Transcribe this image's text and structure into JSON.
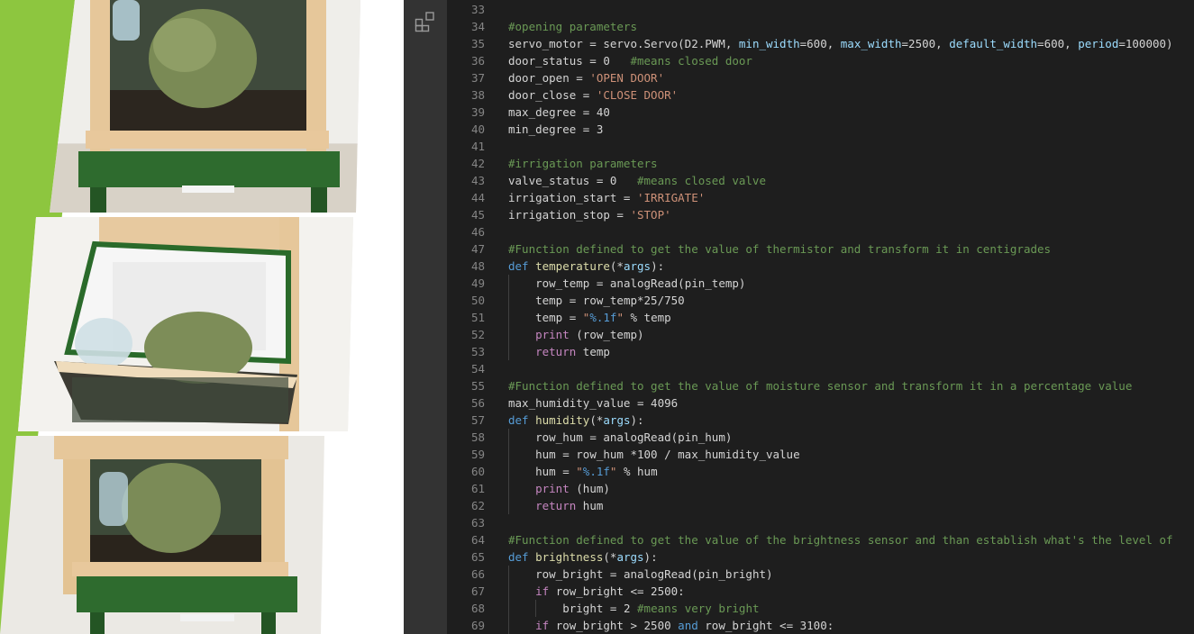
{
  "colors": {
    "editor_bg": "#1e1e1e",
    "activity_bar": "#333333",
    "comment": "#6a9955",
    "keyword": "#569cd6",
    "control": "#c586c0",
    "string": "#ce9178",
    "number": "#b5cea8",
    "function": "#dcdcaa",
    "parameter": "#9cdcfe",
    "text": "#d4d4d4",
    "line_number": "#858585",
    "accent_green": "#8dc63f"
  },
  "activity_bar": {
    "icon": "extensions-icon"
  },
  "photos": [
    {
      "name": "greenhouse-closed-photo"
    },
    {
      "name": "greenhouse-open-photo"
    },
    {
      "name": "greenhouse-closed-front-photo"
    }
  ],
  "code_lines": [
    {
      "n": "33",
      "indent": 0,
      "tokens": []
    },
    {
      "n": "34",
      "indent": 0,
      "tokens": [
        {
          "t": "#opening parameters",
          "c": "cm"
        }
      ]
    },
    {
      "n": "35",
      "indent": 0,
      "tokens": [
        {
          "t": "servo_motor = servo.",
          "c": ""
        },
        {
          "t": "Servo",
          "c": ""
        },
        {
          "t": "(D2.PWM, ",
          "c": ""
        },
        {
          "t": "min_width",
          "c": "par"
        },
        {
          "t": "=600, ",
          "c": ""
        },
        {
          "t": "max_width",
          "c": "par"
        },
        {
          "t": "=2500, ",
          "c": ""
        },
        {
          "t": "default_width",
          "c": "par"
        },
        {
          "t": "=600, ",
          "c": ""
        },
        {
          "t": "period",
          "c": "par"
        },
        {
          "t": "=100000)",
          "c": ""
        }
      ]
    },
    {
      "n": "36",
      "indent": 0,
      "tokens": [
        {
          "t": "door_status = 0   ",
          "c": ""
        },
        {
          "t": "#means closed door",
          "c": "cm"
        }
      ]
    },
    {
      "n": "37",
      "indent": 0,
      "tokens": [
        {
          "t": "door_open = ",
          "c": ""
        },
        {
          "t": "'OPEN DOOR'",
          "c": "str"
        }
      ]
    },
    {
      "n": "38",
      "indent": 0,
      "tokens": [
        {
          "t": "door_close = ",
          "c": ""
        },
        {
          "t": "'CLOSE DOOR'",
          "c": "str"
        }
      ]
    },
    {
      "n": "39",
      "indent": 0,
      "tokens": [
        {
          "t": "max_degree = 40",
          "c": ""
        }
      ]
    },
    {
      "n": "40",
      "indent": 0,
      "tokens": [
        {
          "t": "min_degree = 3",
          "c": ""
        }
      ]
    },
    {
      "n": "41",
      "indent": 0,
      "tokens": []
    },
    {
      "n": "42",
      "indent": 0,
      "tokens": [
        {
          "t": "#irrigation parameters",
          "c": "cm"
        }
      ]
    },
    {
      "n": "43",
      "indent": 0,
      "tokens": [
        {
          "t": "valve_status = 0   ",
          "c": ""
        },
        {
          "t": "#means closed valve",
          "c": "cm"
        }
      ]
    },
    {
      "n": "44",
      "indent": 0,
      "tokens": [
        {
          "t": "irrigation_start = ",
          "c": ""
        },
        {
          "t": "'IRRIGATE'",
          "c": "str"
        }
      ]
    },
    {
      "n": "45",
      "indent": 0,
      "tokens": [
        {
          "t": "irrigation_stop = ",
          "c": ""
        },
        {
          "t": "'STOP'",
          "c": "str"
        }
      ]
    },
    {
      "n": "46",
      "indent": 0,
      "tokens": []
    },
    {
      "n": "47",
      "indent": 0,
      "tokens": [
        {
          "t": "#Function defined to get the value of thermistor and transform it in centigrades",
          "c": "cm"
        }
      ]
    },
    {
      "n": "48",
      "indent": 0,
      "tokens": [
        {
          "t": "def ",
          "c": "kw"
        },
        {
          "t": "temperature",
          "c": "fn"
        },
        {
          "t": "(*",
          "c": ""
        },
        {
          "t": "args",
          "c": "par"
        },
        {
          "t": "):",
          "c": ""
        }
      ]
    },
    {
      "n": "49",
      "indent": 1,
      "tokens": [
        {
          "t": "row_temp = ",
          "c": ""
        },
        {
          "t": "analogRead",
          "c": ""
        },
        {
          "t": "(pin_temp)",
          "c": ""
        }
      ]
    },
    {
      "n": "50",
      "indent": 1,
      "tokens": [
        {
          "t": "temp = row_temp*25/750",
          "c": ""
        }
      ]
    },
    {
      "n": "51",
      "indent": 1,
      "tokens": [
        {
          "t": "temp = ",
          "c": ""
        },
        {
          "t": "\"",
          "c": "str"
        },
        {
          "t": "%.1f",
          "c": "fmt"
        },
        {
          "t": "\"",
          "c": "str"
        },
        {
          "t": " % temp",
          "c": ""
        }
      ]
    },
    {
      "n": "52",
      "indent": 1,
      "tokens": [
        {
          "t": "print",
          "c": "ctl"
        },
        {
          "t": " (row_temp)",
          "c": ""
        }
      ]
    },
    {
      "n": "53",
      "indent": 1,
      "tokens": [
        {
          "t": "return",
          "c": "ctl"
        },
        {
          "t": " temp",
          "c": ""
        }
      ]
    },
    {
      "n": "54",
      "indent": 0,
      "tokens": []
    },
    {
      "n": "55",
      "indent": 0,
      "tokens": [
        {
          "t": "#Function defined to get the value of moisture sensor and transform it in a percentage value",
          "c": "cm"
        }
      ]
    },
    {
      "n": "56",
      "indent": 0,
      "tokens": [
        {
          "t": "max_humidity_value = 4096",
          "c": ""
        }
      ]
    },
    {
      "n": "57",
      "indent": 0,
      "tokens": [
        {
          "t": "def ",
          "c": "kw"
        },
        {
          "t": "humidity",
          "c": "fn"
        },
        {
          "t": "(*",
          "c": ""
        },
        {
          "t": "args",
          "c": "par"
        },
        {
          "t": "):",
          "c": ""
        }
      ]
    },
    {
      "n": "58",
      "indent": 1,
      "tokens": [
        {
          "t": "row_hum = ",
          "c": ""
        },
        {
          "t": "analogRead",
          "c": ""
        },
        {
          "t": "(pin_hum)",
          "c": ""
        }
      ]
    },
    {
      "n": "59",
      "indent": 1,
      "tokens": [
        {
          "t": "hum = row_hum *100 / max_humidity_value",
          "c": ""
        }
      ]
    },
    {
      "n": "60",
      "indent": 1,
      "tokens": [
        {
          "t": "hum = ",
          "c": ""
        },
        {
          "t": "\"",
          "c": "str"
        },
        {
          "t": "%.1f",
          "c": "fmt"
        },
        {
          "t": "\"",
          "c": "str"
        },
        {
          "t": " % hum",
          "c": ""
        }
      ]
    },
    {
      "n": "61",
      "indent": 1,
      "tokens": [
        {
          "t": "print",
          "c": "ctl"
        },
        {
          "t": " (hum)",
          "c": ""
        }
      ]
    },
    {
      "n": "62",
      "indent": 1,
      "tokens": [
        {
          "t": "return",
          "c": "ctl"
        },
        {
          "t": " hum",
          "c": ""
        }
      ]
    },
    {
      "n": "63",
      "indent": 0,
      "tokens": []
    },
    {
      "n": "64",
      "indent": 0,
      "tokens": [
        {
          "t": "#Function defined to get the value of the brightness sensor and than establish what's the level of",
          "c": "cm"
        }
      ]
    },
    {
      "n": "65",
      "indent": 0,
      "tokens": [
        {
          "t": "def ",
          "c": "kw"
        },
        {
          "t": "brightness",
          "c": "fn"
        },
        {
          "t": "(*",
          "c": ""
        },
        {
          "t": "args",
          "c": "par"
        },
        {
          "t": "):",
          "c": ""
        }
      ]
    },
    {
      "n": "66",
      "indent": 1,
      "tokens": [
        {
          "t": "row_bright = ",
          "c": ""
        },
        {
          "t": "analogRead",
          "c": ""
        },
        {
          "t": "(pin_bright)",
          "c": ""
        }
      ]
    },
    {
      "n": "67",
      "indent": 1,
      "tokens": [
        {
          "t": "if",
          "c": "ctl"
        },
        {
          "t": " row_bright <= 2500:",
          "c": ""
        }
      ]
    },
    {
      "n": "68",
      "indent": 2,
      "tokens": [
        {
          "t": "bright = 2 ",
          "c": ""
        },
        {
          "t": "#means very bright",
          "c": "cm"
        }
      ]
    },
    {
      "n": "69",
      "indent": 1,
      "tokens": [
        {
          "t": "if",
          "c": "ctl"
        },
        {
          "t": " row_bright > 2500 ",
          "c": ""
        },
        {
          "t": "and",
          "c": "kw"
        },
        {
          "t": " row_bright <= 3100:",
          "c": ""
        }
      ]
    }
  ]
}
